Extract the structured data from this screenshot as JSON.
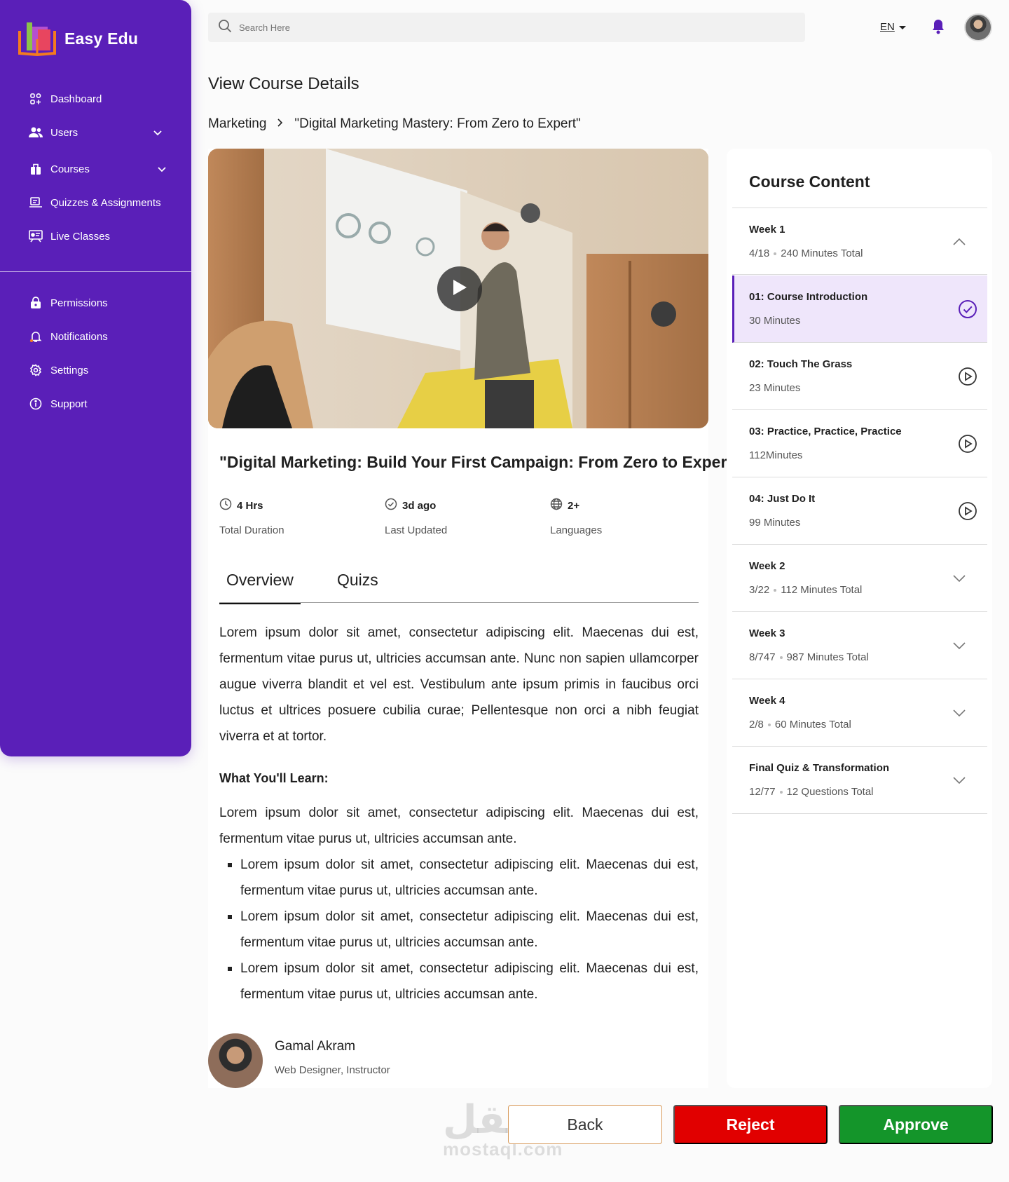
{
  "brand": {
    "name": "Easy Edu"
  },
  "sidebar": {
    "items": [
      {
        "label": "Dashboard",
        "icon": "dashboard-icon"
      },
      {
        "label": "Users",
        "icon": "users-icon",
        "expandable": true
      },
      {
        "label": "Courses",
        "icon": "courses-icon",
        "expandable": true
      },
      {
        "label": "Quizzes & Assignments",
        "icon": "quizzes-icon"
      },
      {
        "label": "Live Classes",
        "icon": "live-classes-icon"
      }
    ],
    "secondary": [
      {
        "label": "Permissions",
        "icon": "lock-icon"
      },
      {
        "label": "Notifications",
        "icon": "bell-icon"
      },
      {
        "label": "Settings",
        "icon": "gear-icon"
      },
      {
        "label": "Support",
        "icon": "info-icon"
      }
    ]
  },
  "header": {
    "search_placeholder": "Search Here",
    "language": "EN"
  },
  "page": {
    "title": "View Course Details",
    "breadcrumb": [
      "Marketing",
      "\"Digital Marketing Mastery: From Zero to Expert\""
    ]
  },
  "course": {
    "title": "\"Digital Marketing: Build Your First Campaign: From Zero to Expert\"",
    "stats": [
      {
        "value": "4 Hrs",
        "label": "Total Duration",
        "icon": "clock-icon"
      },
      {
        "value": "3d ago",
        "label": "Last Updated",
        "icon": "check-circle-icon"
      },
      {
        "value": "2+",
        "label": "Languages",
        "icon": "globe-icon"
      }
    ],
    "tabs": [
      "Overview",
      "Quizs"
    ],
    "overview": "Lorem ipsum dolor sit amet, consectetur adipiscing elit. Maecenas dui est, fermentum vitae purus ut, ultricies accumsan ante. Nunc non sapien ullamcorper augue viverra blandit et vel est. Vestibulum ante ipsum primis in faucibus orci luctus et ultrices posuere cubilia curae; Pellentesque non orci a nibh feugiat viverra et at tortor.",
    "learn_title": "What You'll Learn:",
    "learn_intro": "Lorem ipsum dolor sit amet, consectetur adipiscing elit. Maecenas dui est, fermentum vitae purus ut, ultricies accumsan ante.",
    "learn_points": [
      "Lorem ipsum dolor sit amet, consectetur adipiscing elit. Maecenas dui est, fermentum vitae purus ut, ultricies accumsan ante.",
      "Lorem ipsum dolor sit amet, consectetur adipiscing elit. Maecenas dui est, fermentum vitae purus ut, ultricies accumsan ante.",
      "Lorem ipsum dolor sit amet, consectetur adipiscing elit. Maecenas dui est, fermentum vitae purus ut, ultricies accumsan ante."
    ],
    "instructor": {
      "name": "Gamal Akram",
      "role": "Web Designer, Instructor"
    }
  },
  "content_panel": {
    "title": "Course Content",
    "rows": [
      {
        "title": "Week 1",
        "progress": "4/18",
        "total": "240 Minutes Total",
        "icon": "chevron-up-icon"
      },
      {
        "title": "01: Course Introduction",
        "duration": "30 Minutes",
        "icon": "check-circle-icon",
        "selected": true
      },
      {
        "title": "02: Touch The Grass",
        "duration": "23 Minutes",
        "icon": "play-circle-icon"
      },
      {
        "title": "03: Practice, Practice, Practice",
        "duration": "112Minutes",
        "icon": "play-circle-icon"
      },
      {
        "title": "04: Just Do It",
        "duration": "99 Minutes",
        "icon": "play-circle-icon"
      },
      {
        "title": "Week 2",
        "progress": "3/22",
        "total": "112 Minutes Total",
        "icon": "chevron-down-icon"
      },
      {
        "title": "Week 3",
        "progress": "8/747",
        "total": "987 Minutes Total",
        "icon": "chevron-down-icon"
      },
      {
        "title": "Week 4",
        "progress": "2/8",
        "total": "60 Minutes Total",
        "icon": "chevron-down-icon"
      },
      {
        "title": "Final Quiz & Transformation",
        "progress": "12/77",
        "total": "12 Questions Total",
        "icon": "chevron-down-icon"
      }
    ]
  },
  "actions": {
    "back": "Back",
    "reject": "Reject",
    "approve": "Approve"
  },
  "watermark": {
    "arabic": "مستقل",
    "latin": "mostaql.com"
  },
  "colors": {
    "primary": "#5a1fb8",
    "reject": "#e10000",
    "approve": "#14952a",
    "selected_bg": "#efe6fb"
  }
}
